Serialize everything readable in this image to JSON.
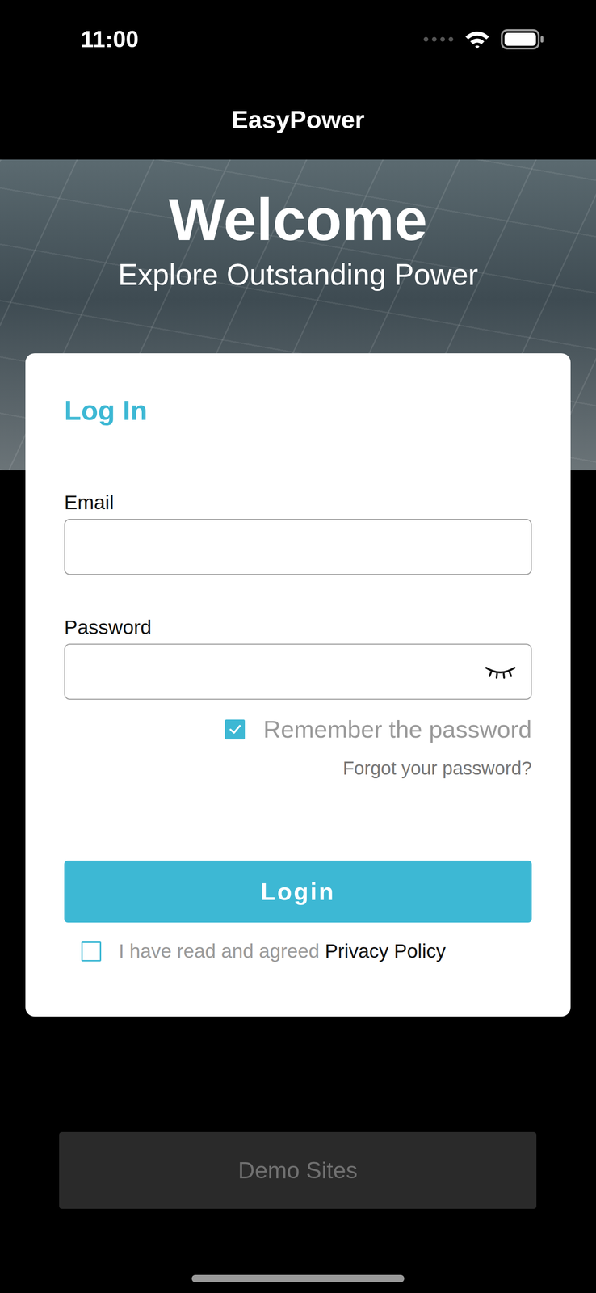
{
  "status_bar": {
    "time": "11:00"
  },
  "nav": {
    "title": "EasyPower"
  },
  "hero": {
    "title": "Welcome",
    "subtitle": "Explore Outstanding Power"
  },
  "login": {
    "title": "Log In",
    "fields": [
      {
        "label": "Email",
        "value": "",
        "kind": "text",
        "masked": false
      },
      {
        "label": "Password",
        "value": "",
        "kind": "password",
        "masked": true
      }
    ],
    "remember": {
      "label": "Remember the password",
      "checked": true
    },
    "forgot": "Forgot your password?",
    "submit": "Login",
    "privacy": {
      "prefix": "I have read and agreed",
      "link": "Privacy Policy",
      "checked": false
    }
  },
  "demo_button": {
    "label": "Demo Sites",
    "disabled": true
  }
}
